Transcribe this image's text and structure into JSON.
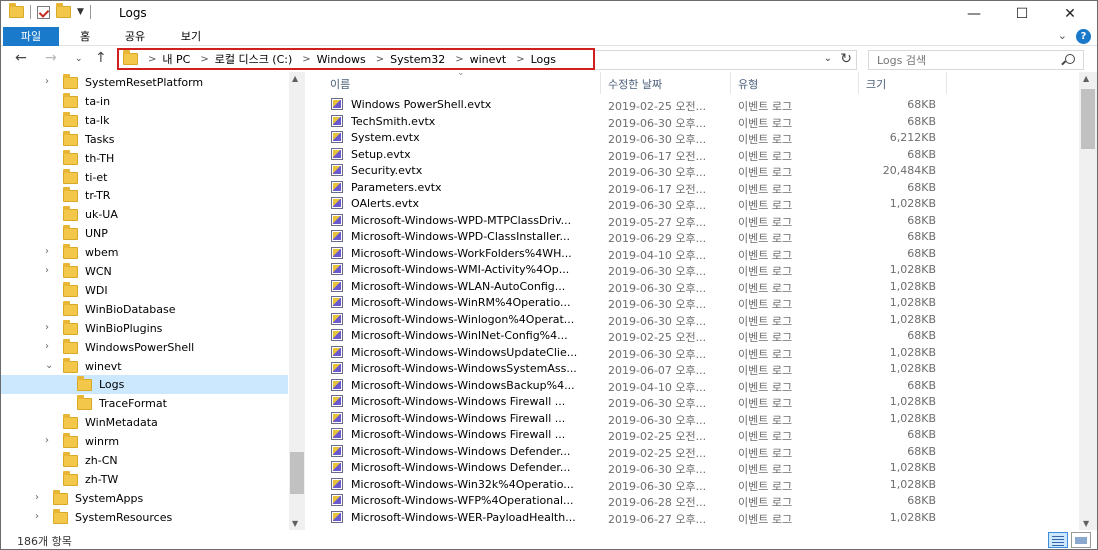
{
  "window": {
    "title": "Logs",
    "minimize": "—",
    "maximize": "☐",
    "close": "✕"
  },
  "ribbon": {
    "tabs": [
      "파일",
      "홈",
      "공유",
      "보기"
    ],
    "collapse": "⌄",
    "help": "?"
  },
  "nav": {
    "back": "←",
    "forward": "→",
    "recent": "⌄",
    "up": "↑",
    "breadcrumb": [
      "내 PC",
      "로컬 디스크 (C:)",
      "Windows",
      "System32",
      "winevt",
      "Logs"
    ],
    "breadcrumb_sep": ">",
    "address_dropdown": "⌄",
    "refresh": "↻",
    "search_placeholder": "Logs 검색"
  },
  "tree": {
    "items": [
      {
        "label": "SystemResetPlatform",
        "expandable": true,
        "level": 2
      },
      {
        "label": "ta-in",
        "expandable": false,
        "level": 2
      },
      {
        "label": "ta-lk",
        "expandable": false,
        "level": 2
      },
      {
        "label": "Tasks",
        "expandable": false,
        "level": 2
      },
      {
        "label": "th-TH",
        "expandable": false,
        "level": 2
      },
      {
        "label": "ti-et",
        "expandable": false,
        "level": 2
      },
      {
        "label": "tr-TR",
        "expandable": false,
        "level": 2
      },
      {
        "label": "uk-UA",
        "expandable": false,
        "level": 2
      },
      {
        "label": "UNP",
        "expandable": false,
        "level": 2
      },
      {
        "label": "wbem",
        "expandable": true,
        "level": 2
      },
      {
        "label": "WCN",
        "expandable": true,
        "level": 2
      },
      {
        "label": "WDI",
        "expandable": false,
        "level": 2
      },
      {
        "label": "WinBioDatabase",
        "expandable": false,
        "level": 2
      },
      {
        "label": "WinBioPlugins",
        "expandable": true,
        "level": 2
      },
      {
        "label": "WindowsPowerShell",
        "expandable": true,
        "level": 2
      },
      {
        "label": "winevt",
        "expandable": true,
        "expanded": true,
        "level": 2
      },
      {
        "label": "Logs",
        "expandable": false,
        "level": 3,
        "selected": true
      },
      {
        "label": "TraceFormat",
        "expandable": false,
        "level": 3
      },
      {
        "label": "WinMetadata",
        "expandable": false,
        "level": 2
      },
      {
        "label": "winrm",
        "expandable": true,
        "level": 2
      },
      {
        "label": "zh-CN",
        "expandable": false,
        "level": 2
      },
      {
        "label": "zh-TW",
        "expandable": false,
        "level": 2
      },
      {
        "label": "SystemApps",
        "expandable": true,
        "level": 1
      },
      {
        "label": "SystemResources",
        "expandable": true,
        "level": 1
      }
    ]
  },
  "columns": {
    "name": "이름",
    "date": "수정한 날짜",
    "type": "유형",
    "size": "크기",
    "sort_indicator": "⌄"
  },
  "files": [
    {
      "name": "Windows PowerShell.evtx",
      "date": "2019-02-25 오전...",
      "type": "이벤트 로그",
      "size": "68KB"
    },
    {
      "name": "TechSmith.evtx",
      "date": "2019-06-30 오후...",
      "type": "이벤트 로그",
      "size": "68KB"
    },
    {
      "name": "System.evtx",
      "date": "2019-06-30 오후...",
      "type": "이벤트 로그",
      "size": "6,212KB"
    },
    {
      "name": "Setup.evtx",
      "date": "2019-06-17 오전...",
      "type": "이벤트 로그",
      "size": "68KB"
    },
    {
      "name": "Security.evtx",
      "date": "2019-06-30 오후...",
      "type": "이벤트 로그",
      "size": "20,484KB"
    },
    {
      "name": "Parameters.evtx",
      "date": "2019-06-17 오전...",
      "type": "이벤트 로그",
      "size": "68KB"
    },
    {
      "name": "OAlerts.evtx",
      "date": "2019-06-30 오후...",
      "type": "이벤트 로그",
      "size": "1,028KB"
    },
    {
      "name": "Microsoft-Windows-WPD-MTPClassDriv...",
      "date": "2019-05-27 오후...",
      "type": "이벤트 로그",
      "size": "68KB"
    },
    {
      "name": "Microsoft-Windows-WPD-ClassInstaller...",
      "date": "2019-06-29 오후...",
      "type": "이벤트 로그",
      "size": "68KB"
    },
    {
      "name": "Microsoft-Windows-WorkFolders%4WH...",
      "date": "2019-04-10 오후...",
      "type": "이벤트 로그",
      "size": "68KB"
    },
    {
      "name": "Microsoft-Windows-WMI-Activity%4Op...",
      "date": "2019-06-30 오후...",
      "type": "이벤트 로그",
      "size": "1,028KB"
    },
    {
      "name": "Microsoft-Windows-WLAN-AutoConfig...",
      "date": "2019-06-30 오후...",
      "type": "이벤트 로그",
      "size": "1,028KB"
    },
    {
      "name": "Microsoft-Windows-WinRM%4Operatio...",
      "date": "2019-06-30 오후...",
      "type": "이벤트 로그",
      "size": "1,028KB"
    },
    {
      "name": "Microsoft-Windows-Winlogon%4Operat...",
      "date": "2019-06-30 오후...",
      "type": "이벤트 로그",
      "size": "1,028KB"
    },
    {
      "name": "Microsoft-Windows-WinINet-Config%4...",
      "date": "2019-02-25 오전...",
      "type": "이벤트 로그",
      "size": "68KB"
    },
    {
      "name": "Microsoft-Windows-WindowsUpdateClie...",
      "date": "2019-06-30 오후...",
      "type": "이벤트 로그",
      "size": "1,028KB"
    },
    {
      "name": "Microsoft-Windows-WindowsSystemAss...",
      "date": "2019-06-07 오후...",
      "type": "이벤트 로그",
      "size": "1,028KB"
    },
    {
      "name": "Microsoft-Windows-WindowsBackup%4...",
      "date": "2019-04-10 오후...",
      "type": "이벤트 로그",
      "size": "68KB"
    },
    {
      "name": "Microsoft-Windows-Windows Firewall ...",
      "date": "2019-06-30 오후...",
      "type": "이벤트 로그",
      "size": "1,028KB"
    },
    {
      "name": "Microsoft-Windows-Windows Firewall ...",
      "date": "2019-06-30 오후...",
      "type": "이벤트 로그",
      "size": "1,028KB"
    },
    {
      "name": "Microsoft-Windows-Windows Firewall ...",
      "date": "2019-02-25 오전...",
      "type": "이벤트 로그",
      "size": "68KB"
    },
    {
      "name": "Microsoft-Windows-Windows Defender...",
      "date": "2019-02-25 오전...",
      "type": "이벤트 로그",
      "size": "68KB"
    },
    {
      "name": "Microsoft-Windows-Windows Defender...",
      "date": "2019-06-30 오후...",
      "type": "이벤트 로그",
      "size": "1,028KB"
    },
    {
      "name": "Microsoft-Windows-Win32k%4Operatio...",
      "date": "2019-06-30 오후...",
      "type": "이벤트 로그",
      "size": "1,028KB"
    },
    {
      "name": "Microsoft-Windows-WFP%4Operational...",
      "date": "2019-06-28 오전...",
      "type": "이벤트 로그",
      "size": "68KB"
    },
    {
      "name": "Microsoft-Windows-WER-PayloadHealth...",
      "date": "2019-06-27 오후...",
      "type": "이벤트 로그",
      "size": "1,028KB"
    }
  ],
  "status": {
    "item_count": "186개 항목"
  },
  "colors": {
    "accent": "#1979ca",
    "selection": "#cce8ff",
    "address_highlight": "#d11e1e",
    "folder": "#f3c84a"
  }
}
